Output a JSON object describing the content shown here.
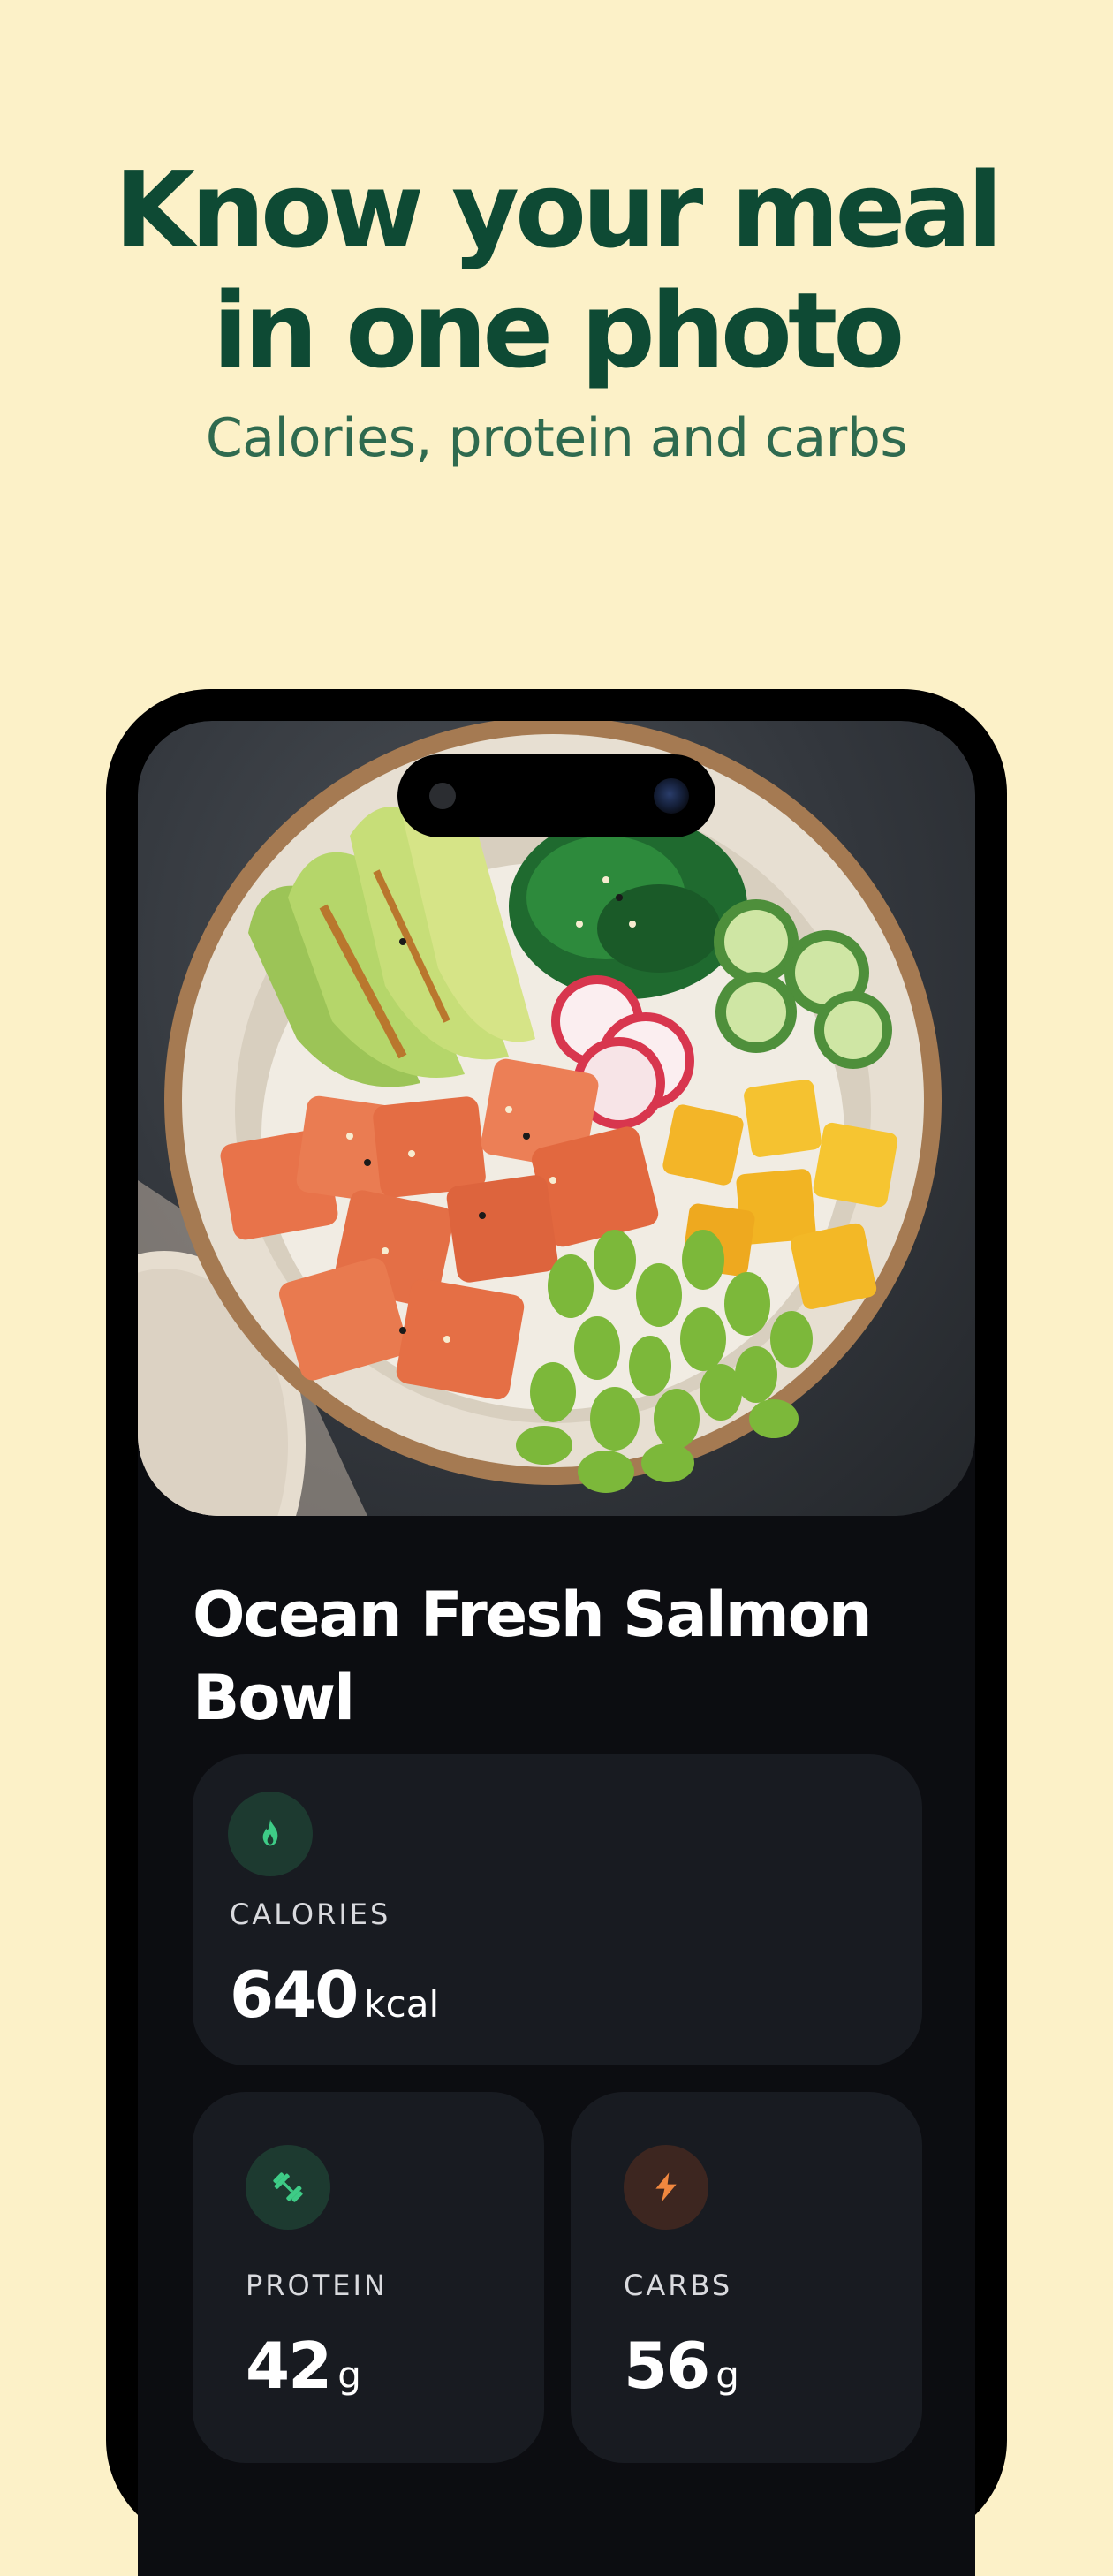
{
  "hero": {
    "title_line1": "Know your meal",
    "title_line2": "in one photo",
    "subtitle": "Calories, protein and carbs"
  },
  "meal": {
    "name": "Ocean Fresh Salmon Bowl"
  },
  "nutrition": {
    "calories": {
      "label": "CALORIES",
      "value": "640",
      "unit": "kcal",
      "icon": "flame-icon",
      "accent": "#3ecb86"
    },
    "protein": {
      "label": "PROTEIN",
      "value": "42",
      "unit": "g",
      "icon": "dumbbell-icon",
      "accent": "#3ecb86"
    },
    "carbs": {
      "label": "CARBS",
      "value": "56",
      "unit": "g",
      "icon": "lightning-bolt-icon",
      "accent": "#f0873f"
    }
  },
  "colors": {
    "background": "#fcf1c8",
    "heading": "#0e4a34",
    "screen": "#0c0d11",
    "card": "#181b21"
  }
}
